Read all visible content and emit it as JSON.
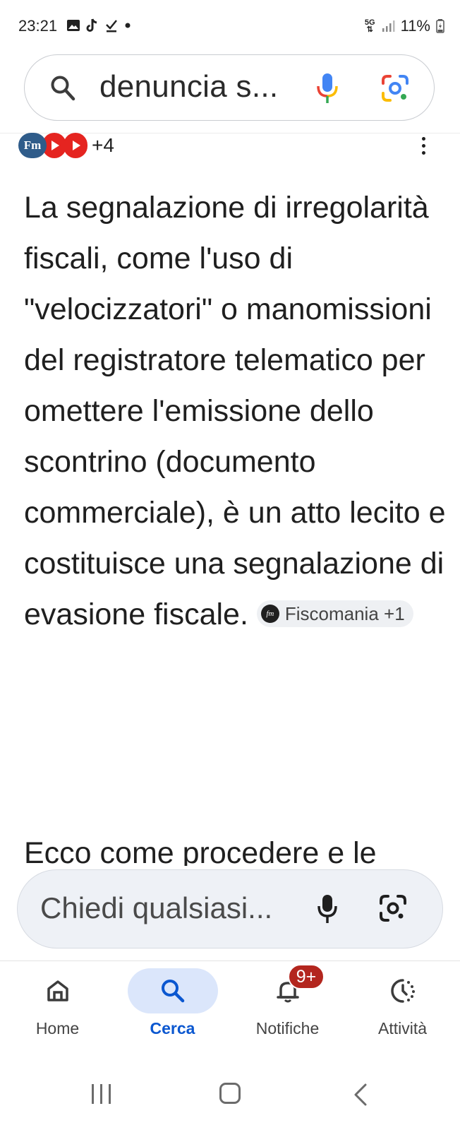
{
  "status_bar": {
    "time": "23:21",
    "network": "5G",
    "battery": "11%"
  },
  "search": {
    "query": "denuncia s..."
  },
  "sources": {
    "first_logo": "Fm",
    "more_count": "+4"
  },
  "answer": {
    "paragraph1": "La segnalazione di irregolarità fiscali, come l'uso di \"velocizzatori\" o manomissioni del registratore telematico per omettere l'emissione dello scontrino (documento commerciale), è un atto lecito e costituisce una segnalazione di evasione fiscale.",
    "source_chip_logo": "fm",
    "source_chip_label": "Fiscomania +1",
    "paragraph2": "Ecco come procedere e le"
  },
  "ask": {
    "placeholder": "Chiedi qualsiasi..."
  },
  "bottom_nav": {
    "items": [
      {
        "label": "Home",
        "icon": "home-icon"
      },
      {
        "label": "Cerca",
        "icon": "search-icon",
        "active": true
      },
      {
        "label": "Notifiche",
        "icon": "bell-icon",
        "badge": "9+"
      },
      {
        "label": "Attività",
        "icon": "activity-icon"
      }
    ]
  },
  "colors": {
    "accent": "#0b57d0",
    "active_pill": "#dbe6fb",
    "badge": "#b3261e",
    "youtube_red": "#e52420",
    "fiscomania_blue": "#2f5c8a"
  }
}
